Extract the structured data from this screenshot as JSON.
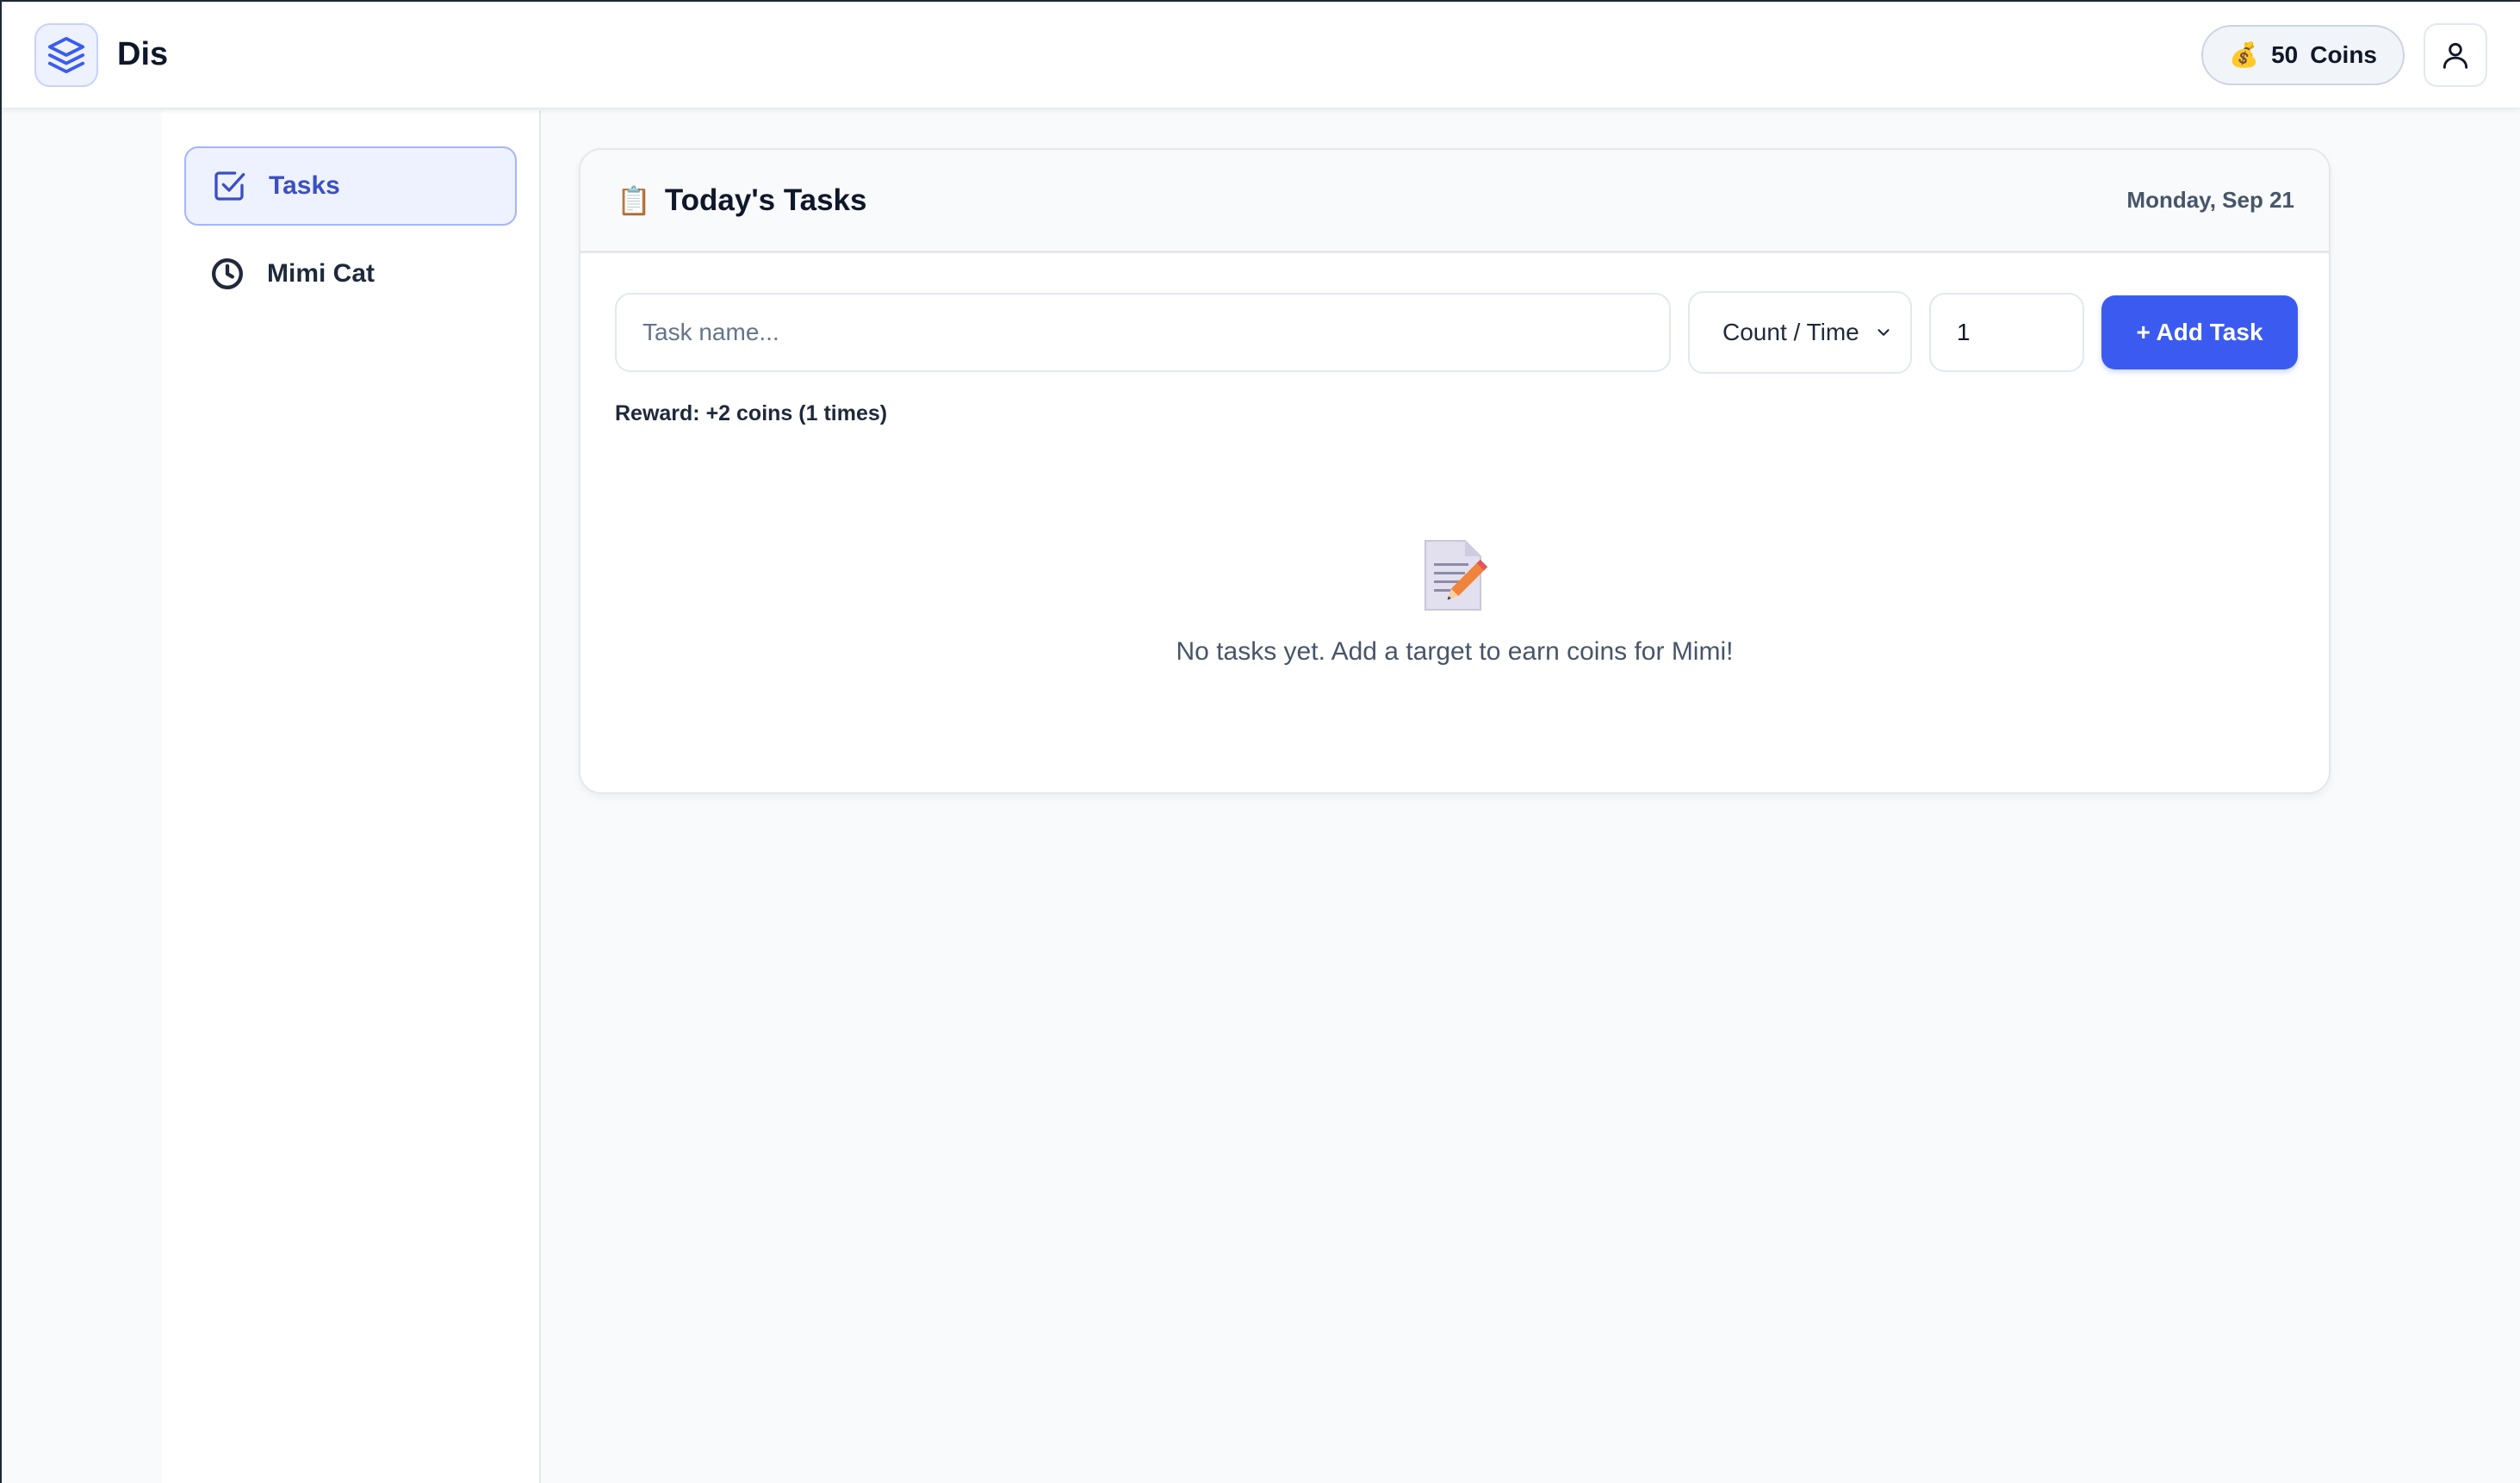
{
  "header": {
    "brand": "Dis",
    "coins_icon": "💰",
    "coins_amount": "50",
    "coins_label": "Coins"
  },
  "sidebar": {
    "items": [
      {
        "label": "Tasks",
        "icon": "check-square-icon",
        "active": true
      },
      {
        "label": "Mimi Cat",
        "icon": "clock-icon",
        "active": false
      }
    ]
  },
  "main": {
    "title_emoji": "📋",
    "title": "Today's Tasks",
    "date": "Monday, Sep 21",
    "form": {
      "task_placeholder": "Task name...",
      "task_value": "",
      "type_selected": "Count / Time",
      "quantity_value": "1",
      "add_label": "+ Add Task"
    },
    "reward": "Reward: +2 coins (1 times)",
    "empty": {
      "message": "No tasks yet. Add a target to earn coins for Mimi!"
    }
  },
  "colors": {
    "accent": "#3b5bf0",
    "active_bg": "#eef2ff",
    "active_text": "#3b4fc4"
  }
}
